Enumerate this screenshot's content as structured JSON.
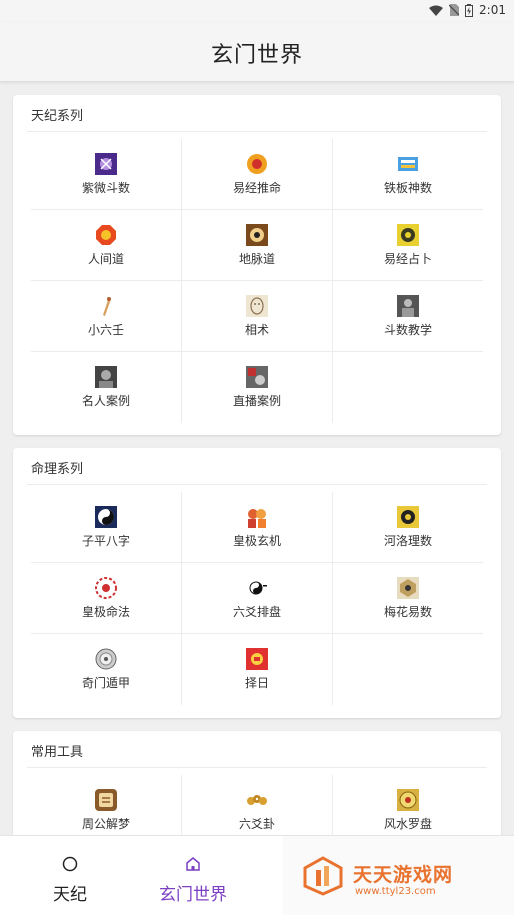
{
  "status": {
    "time": "2:01"
  },
  "app": {
    "title": "玄门世界"
  },
  "sections": [
    {
      "title": "天纪系列",
      "items": [
        "紫微斗数",
        "易经推命",
        "铁板神数",
        "人间道",
        "地脉道",
        "易经占卜",
        "小六壬",
        "相术",
        "斗数教学",
        "名人案例",
        "直播案例"
      ]
    },
    {
      "title": "命理系列",
      "items": [
        "子平八字",
        "皇极玄机",
        "河洛理数",
        "皇极命法",
        "六爻排盘",
        "梅花易数",
        "奇门遁甲",
        "择日"
      ]
    },
    {
      "title": "常用工具",
      "items": [
        "周公解梦",
        "六爻卦",
        "风水罗盘"
      ]
    }
  ],
  "tabs": [
    {
      "label": "天纪",
      "icon": "circle-icon",
      "active": false
    },
    {
      "label": "玄门世界",
      "icon": "home-icon",
      "active": true
    }
  ],
  "watermark": {
    "text": "天天游戏网",
    "url": "www.ttyl23.com"
  },
  "colors": {
    "accent": "#7b3fc4",
    "watermark": "#e8722e"
  }
}
